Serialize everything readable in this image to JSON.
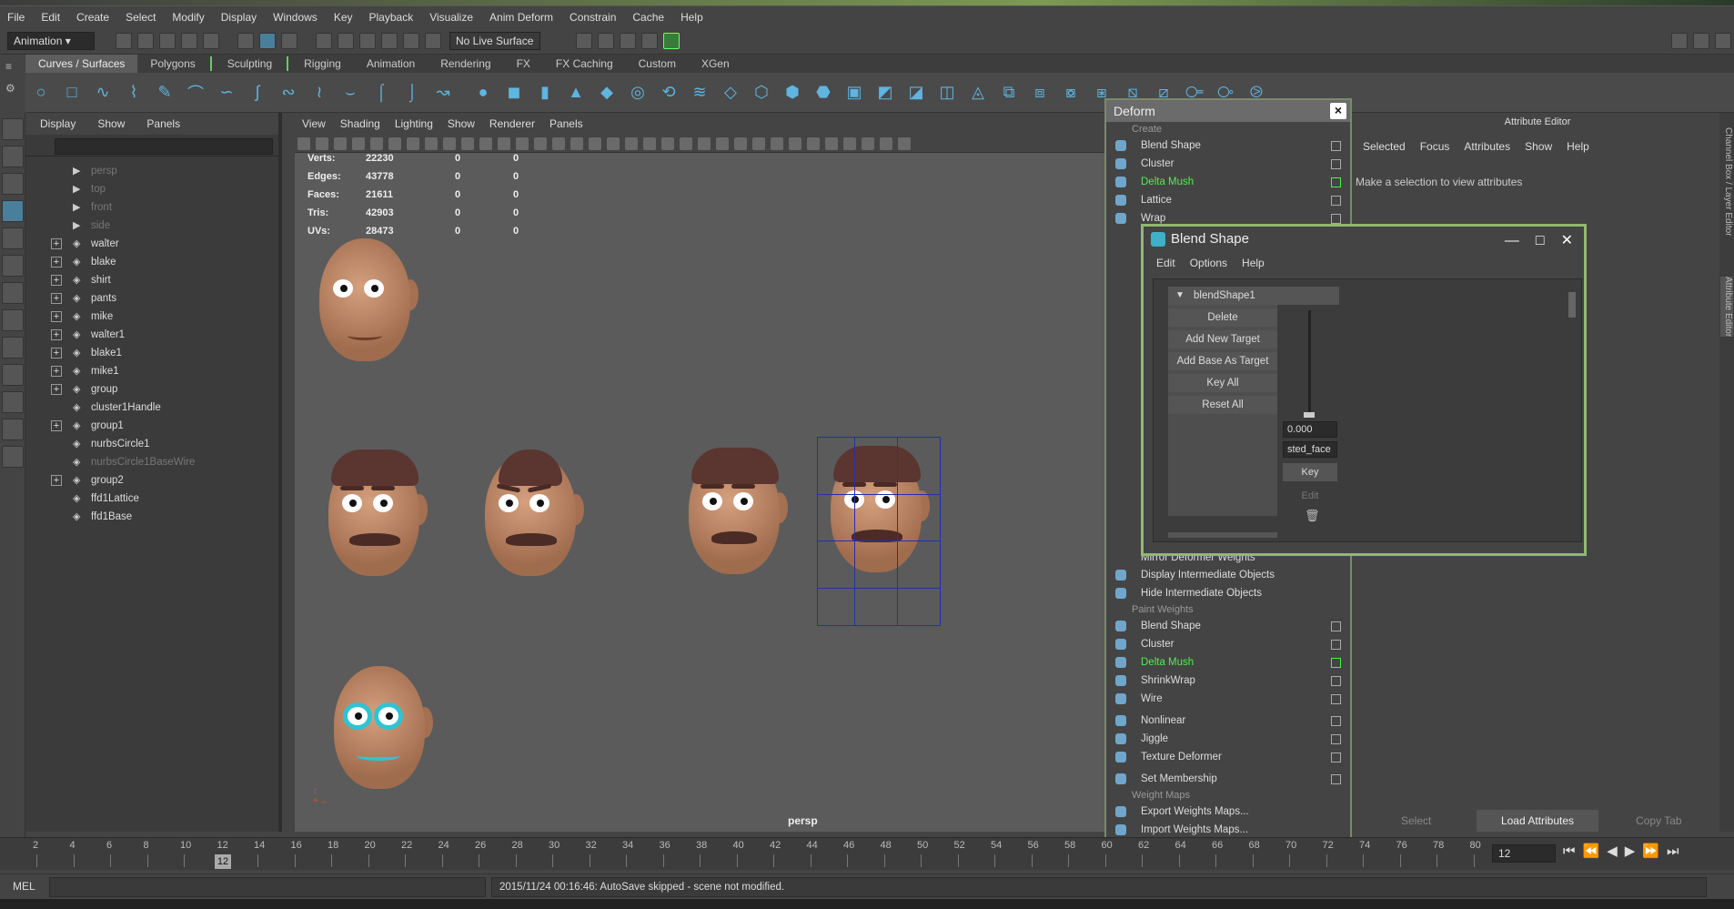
{
  "menubar": [
    "File",
    "Edit",
    "Create",
    "Select",
    "Modify",
    "Display",
    "Windows",
    "Key",
    "Playback",
    "Visualize",
    "Anim Deform",
    "Constrain",
    "Cache",
    "Help"
  ],
  "statusline": {
    "mode": "Animation",
    "live_surface": "No Live Surface"
  },
  "shelf_tabs": [
    "Curves / Surfaces",
    "Polygons",
    "Sculpting",
    "Rigging",
    "Animation",
    "Rendering",
    "FX",
    "FX Caching",
    "Custom",
    "XGen"
  ],
  "outliner": {
    "menu": [
      "Display",
      "Show",
      "Panels"
    ],
    "items": [
      {
        "label": "persp",
        "dim": true,
        "exp": false
      },
      {
        "label": "top",
        "dim": true,
        "exp": false
      },
      {
        "label": "front",
        "dim": true,
        "exp": false
      },
      {
        "label": "side",
        "dim": true,
        "exp": false
      },
      {
        "label": "walter",
        "dim": false,
        "exp": true
      },
      {
        "label": "blake",
        "dim": false,
        "exp": true
      },
      {
        "label": "shirt",
        "dim": false,
        "exp": true
      },
      {
        "label": "pants",
        "dim": false,
        "exp": true
      },
      {
        "label": "mike",
        "dim": false,
        "exp": true
      },
      {
        "label": "walter1",
        "dim": false,
        "exp": true
      },
      {
        "label": "blake1",
        "dim": false,
        "exp": true
      },
      {
        "label": "mike1",
        "dim": false,
        "exp": true
      },
      {
        "label": "group",
        "dim": false,
        "exp": true
      },
      {
        "label": "cluster1Handle",
        "dim": false,
        "exp": false
      },
      {
        "label": "group1",
        "dim": false,
        "exp": true
      },
      {
        "label": "nurbsCircle1",
        "dim": false,
        "exp": false
      },
      {
        "label": "nurbsCircle1BaseWire",
        "dim": true,
        "exp": false
      },
      {
        "label": "group2",
        "dim": false,
        "exp": true
      },
      {
        "label": "ffd1Lattice",
        "dim": false,
        "exp": false
      },
      {
        "label": "ffd1Base",
        "dim": false,
        "exp": false
      }
    ]
  },
  "viewport": {
    "menu": [
      "View",
      "Shading",
      "Lighting",
      "Show",
      "Renderer",
      "Panels"
    ],
    "hud": [
      {
        "label": "Verts:",
        "a": "22230",
        "b": "0",
        "c": "0"
      },
      {
        "label": "Edges:",
        "a": "43778",
        "b": "0",
        "c": "0"
      },
      {
        "label": "Faces:",
        "a": "21611",
        "b": "0",
        "c": "0"
      },
      {
        "label": "Tris:",
        "a": "42903",
        "b": "0",
        "c": "0"
      },
      {
        "label": "UVs:",
        "a": "28473",
        "b": "0",
        "c": "0"
      }
    ],
    "camera_label": "persp"
  },
  "deform": {
    "title": "Deform",
    "create_label": "Create",
    "create_items": [
      {
        "label": "Blend Shape",
        "hl": false
      },
      {
        "label": "Cluster",
        "hl": false
      },
      {
        "label": "Delta Mush",
        "hl": true
      },
      {
        "label": "Lattice",
        "hl": false
      },
      {
        "label": "Wrap",
        "hl": false
      }
    ],
    "mirror_label": "Mirror Deformer Weights",
    "mid_items": [
      "Display Intermediate Objects",
      "Hide Intermediate Objects"
    ],
    "paint_label": "Paint Weights",
    "paint_items": [
      {
        "label": "Blend Shape",
        "hl": false
      },
      {
        "label": "Cluster",
        "hl": false
      },
      {
        "label": "Delta Mush",
        "hl": true
      },
      {
        "label": "ShrinkWrap",
        "hl": false
      },
      {
        "label": "Wire",
        "hl": false
      },
      {
        "label": "Nonlinear",
        "hl": false
      },
      {
        "label": "Jiggle",
        "hl": false
      },
      {
        "label": "Texture Deformer",
        "hl": false
      },
      {
        "label": "Set Membership",
        "hl": false
      }
    ],
    "weights_label": "Weight Maps",
    "weights_items": [
      "Export Weights Maps...",
      "Import Weights Maps..."
    ]
  },
  "blend": {
    "title": "Blend Shape",
    "menu": [
      "Edit",
      "Options",
      "Help"
    ],
    "node": "blendShape1",
    "buttons": [
      "Delete",
      "Add New Target",
      "Add Base As Target",
      "Key All",
      "Reset All"
    ],
    "value": "0.000",
    "target": "sted_face",
    "key": "Key",
    "edit": "Edit"
  },
  "attr": {
    "title": "Attribute Editor",
    "menu": [
      "Selected",
      "Focus",
      "Attributes",
      "Show",
      "Help"
    ],
    "message": "Make a selection to view attributes",
    "bottom": [
      "Select",
      "Load Attributes",
      "Copy Tab"
    ],
    "side_tabs": [
      "Channel Box / Layer Editor",
      "Attribute Editor"
    ]
  },
  "timeline": {
    "ticks": [
      "2",
      "4",
      "6",
      "8",
      "10",
      "12",
      "14",
      "16",
      "18",
      "20",
      "22",
      "24",
      "26",
      "28",
      "30",
      "32",
      "34",
      "36",
      "38",
      "40",
      "42",
      "44",
      "46",
      "48",
      "50",
      "52",
      "54",
      "56",
      "58",
      "60",
      "62",
      "64",
      "66",
      "68",
      "70",
      "72",
      "74",
      "76",
      "78",
      "80"
    ],
    "current": "12"
  },
  "cmd": {
    "mel": "MEL",
    "feedback": "2015/11/24 00:16:46: AutoSave skipped - scene not modified."
  }
}
